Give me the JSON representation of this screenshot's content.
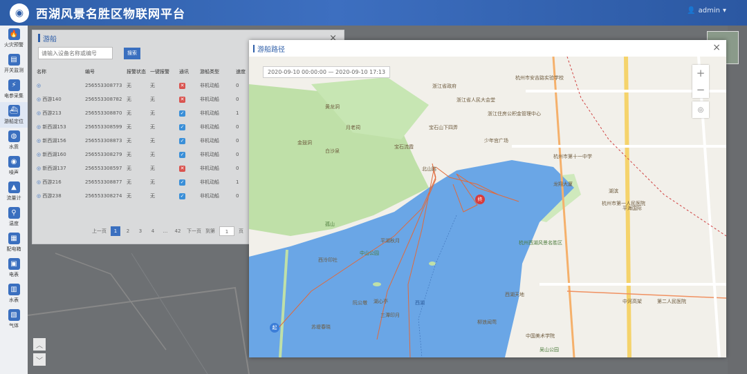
{
  "app": {
    "title": "西湖风景名胜区物联网平台",
    "user": "admin"
  },
  "sidebar": {
    "items": [
      {
        "label": "火灾预警",
        "icon": "fire-icon",
        "glyph": "🔥"
      },
      {
        "label": "开关监测",
        "icon": "switch-icon",
        "glyph": "▤"
      },
      {
        "label": "电参采集",
        "icon": "power-icon",
        "glyph": "⚡"
      },
      {
        "label": "游船定位",
        "icon": "boat-icon",
        "glyph": "⛴"
      },
      {
        "label": "水质",
        "icon": "water-drop-icon",
        "glyph": "◍"
      },
      {
        "label": "噪声",
        "icon": "noise-icon",
        "glyph": "◉"
      },
      {
        "label": "流量计",
        "icon": "flow-meter-icon",
        "glyph": "▲"
      },
      {
        "label": "温度",
        "icon": "temperature-icon",
        "glyph": "⚲"
      },
      {
        "label": "配电箱",
        "icon": "distribution-box-icon",
        "glyph": "▦"
      },
      {
        "label": "电表",
        "icon": "electric-meter-icon",
        "glyph": "▣"
      },
      {
        "label": "水表",
        "icon": "water-meter-icon",
        "glyph": "▥"
      },
      {
        "label": "气体",
        "icon": "gas-icon",
        "glyph": "▧"
      }
    ]
  },
  "boat_panel": {
    "title": "游船",
    "close": "×",
    "search_placeholder": "请输入设备名称或编号",
    "search_button": "搜索",
    "columns": [
      "名称",
      "编号",
      "报警状态",
      "一键报警",
      "通讯",
      "游船类型",
      "速度"
    ],
    "rows": [
      {
        "name": "",
        "code": "256553308773",
        "alarm": "无",
        "onekey": "无",
        "comm": "off",
        "type": "非机动船",
        "speed": "0"
      },
      {
        "name": "西游140",
        "code": "256553308782",
        "alarm": "无",
        "onekey": "无",
        "comm": "off",
        "type": "非机动船",
        "speed": "0"
      },
      {
        "name": "西游213",
        "code": "256553308870",
        "alarm": "无",
        "onekey": "无",
        "comm": "on",
        "type": "非机动船",
        "speed": "1"
      },
      {
        "name": "新西湖153",
        "code": "256553308599",
        "alarm": "无",
        "onekey": "无",
        "comm": "on",
        "type": "非机动船",
        "speed": "0"
      },
      {
        "name": "新西湖156",
        "code": "256553308873",
        "alarm": "无",
        "onekey": "无",
        "comm": "on",
        "type": "非机动船",
        "speed": "0"
      },
      {
        "name": "新西湖160",
        "code": "256553308279",
        "alarm": "无",
        "onekey": "无",
        "comm": "on",
        "type": "非机动船",
        "speed": "0"
      },
      {
        "name": "新西湖137",
        "code": "256553308597",
        "alarm": "无",
        "onekey": "无",
        "comm": "off",
        "type": "非机动船",
        "speed": "0"
      },
      {
        "name": "西游216",
        "code": "256553308877",
        "alarm": "无",
        "onekey": "无",
        "comm": "on",
        "type": "非机动船",
        "speed": "1"
      },
      {
        "name": "西游238",
        "code": "256553308274",
        "alarm": "无",
        "onekey": "无",
        "comm": "on",
        "type": "非机动船",
        "speed": "0"
      }
    ],
    "pager": {
      "prev": "上一页",
      "pages": [
        "1",
        "2",
        "3",
        "4",
        "...",
        "42"
      ],
      "next": "下一页",
      "goto": "到第",
      "page_value": "1",
      "page_unit": "页"
    }
  },
  "route_dialog": {
    "title": "游船路径",
    "close": "×",
    "time_range": "2020-09-10 00:00:00 — 2020-09-10 17:13",
    "zoom_in": "+",
    "zoom_out": "−",
    "start_marker": "起",
    "end_marker": "终",
    "labels": [
      {
        "t": "黄龙洞",
        "c": ""
      },
      {
        "t": "浙江省人民大会堂",
        "c": ""
      },
      {
        "t": "杭州市安吉路实验学校",
        "c": ""
      },
      {
        "t": "浙江省政府",
        "c": ""
      },
      {
        "t": "浙江住房公积金管理中心",
        "c": ""
      },
      {
        "t": "宝石山下四弄",
        "c": ""
      },
      {
        "t": "月老祠",
        "c": ""
      },
      {
        "t": "金鼓洞",
        "c": ""
      },
      {
        "t": "白沙泉",
        "c": ""
      },
      {
        "t": "宝石流霞",
        "c": ""
      },
      {
        "t": "少年宫广场",
        "c": ""
      },
      {
        "t": "杭州市第十一中学",
        "c": ""
      },
      {
        "t": "西湖",
        "c": "b"
      },
      {
        "t": "北山路",
        "c": ""
      },
      {
        "t": "孤山",
        "c": "g"
      },
      {
        "t": "西泠印社",
        "c": ""
      },
      {
        "t": "平湖秋月",
        "c": ""
      },
      {
        "t": "中山公园",
        "c": "g"
      },
      {
        "t": "湖心亭",
        "c": ""
      },
      {
        "t": "阮公墩",
        "c": ""
      },
      {
        "t": "三潭印月",
        "c": ""
      },
      {
        "t": "苏堤春晓",
        "c": ""
      },
      {
        "t": "西湖天地",
        "c": ""
      },
      {
        "t": "柳浪闻莺",
        "c": ""
      },
      {
        "t": "杭州西湖风景名胜区",
        "c": "g"
      },
      {
        "t": "龙翔大厦",
        "c": ""
      },
      {
        "t": "杭州市第一人民医院",
        "c": ""
      },
      {
        "t": "平海国际",
        "c": ""
      },
      {
        "t": "湖滨",
        "c": ""
      },
      {
        "t": "中河高架",
        "c": ""
      },
      {
        "t": "第二人民医院",
        "c": ""
      },
      {
        "t": "吴山公园",
        "c": "g"
      },
      {
        "t": "中国美术学院",
        "c": ""
      }
    ]
  },
  "colors": {
    "brand": "#2e5ea8",
    "route": "#e06a3c",
    "water": "#6aa6e6",
    "park": "#bfe0a8"
  }
}
